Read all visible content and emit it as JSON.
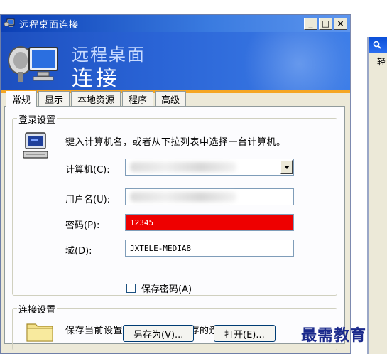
{
  "window": {
    "title": "远程桌面连接",
    "controls": {
      "minimize": "_",
      "maximize": "□",
      "close": "×"
    }
  },
  "banner": {
    "line1": "远程桌面",
    "line2": "连接"
  },
  "tabs": [
    {
      "label": "常规",
      "active": true
    },
    {
      "label": "显示",
      "active": false
    },
    {
      "label": "本地资源",
      "active": false
    },
    {
      "label": "程序",
      "active": false
    },
    {
      "label": "高级",
      "active": false
    }
  ],
  "logon": {
    "group_label": "登录设置",
    "hint": "键入计算机名，或者从下拉列表中选择一台计算机。",
    "computer_label": "计算机(C):",
    "computer_value": "",
    "username_label": "用户名(U):",
    "username_value": "",
    "password_label": "密码(P):",
    "password_value": "12345",
    "domain_label": "域(D):",
    "domain_value": "JXTELE-MEDIA8",
    "save_password_label": "保存密码(A)",
    "save_password_checked": false
  },
  "connection": {
    "group_label": "连接设置",
    "hint": "保存当前设置，或者打开已保存的连接。",
    "save_as_label": "另存为(V)...",
    "open_label": "打开(E)..."
  },
  "background_window": {
    "text": "轻"
  },
  "watermark": "最需教育",
  "colors": {
    "title_bar": "#0b3fb5",
    "password_bg": "#ee0000",
    "banner": "#2a64d6",
    "accent_stripe": "#f5a623"
  }
}
